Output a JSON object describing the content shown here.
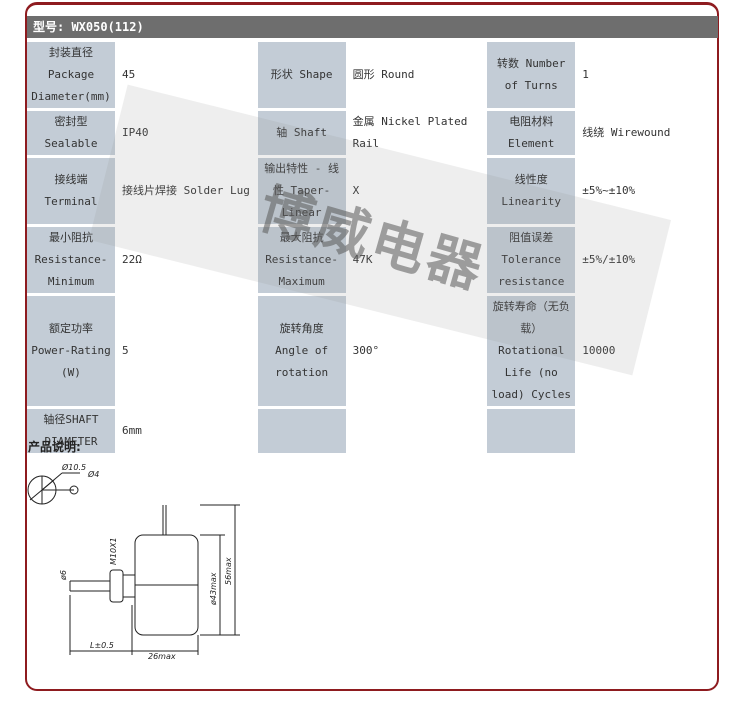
{
  "header": {
    "model_label": "型号: WX050(112)"
  },
  "spec_table": {
    "rows": [
      [
        {
          "label": "封装直径 Package Diameter(mm)",
          "value": "45"
        },
        {
          "label": "形状 Shape",
          "value": "圆形 Round"
        },
        {
          "label": "转数 Number of Turns",
          "value": "1"
        }
      ],
      [
        {
          "label": "密封型 Sealable",
          "value": "IP40"
        },
        {
          "label": "轴 Shaft",
          "value": "金属 Nickel Plated Rail"
        },
        {
          "label": "电阻材料 Element",
          "value": "线绕 Wirewound"
        }
      ],
      [
        {
          "label": "接线端 Terminal",
          "value": "接线片焊接 Solder Lug"
        },
        {
          "label": "输出特性 - 线性 Taper-Linear",
          "value": "X"
        },
        {
          "label": "线性度 Linearity",
          "value": "±5%~±10%"
        }
      ],
      [
        {
          "label": "最小阻抗 Resistance-Minimum",
          "value": "22Ω"
        },
        {
          "label": "最大阻抗 Resistance-Maximum",
          "value": "47K"
        },
        {
          "label": "阻值误差 Tolerance resistance",
          "value": "±5%/±10%"
        }
      ],
      [
        {
          "label": "额定功率 Power-Rating (W)",
          "value": "5"
        },
        {
          "label": "旋转角度 Angle of rotation",
          "value": "300°"
        },
        {
          "label": "旋转寿命（无负载）Rotational Life (no load) Cycles",
          "value": "10000"
        }
      ],
      [
        {
          "label": "轴径SHAFT DIAMETER",
          "value": "6mm"
        },
        {
          "label": "",
          "value": ""
        },
        {
          "label": "",
          "value": ""
        }
      ]
    ]
  },
  "watermark": {
    "text": "博威电器"
  },
  "description": {
    "title": "产品说明:",
    "dimensions": {
      "hole_large": "Ø10.5",
      "hole_small": "Ø4",
      "thread": "M10X1",
      "shaft_dia": "ø6",
      "body_dia": "ø43max",
      "overall_height": "56max",
      "shaft_length": "L±0.5",
      "body_depth": "26max"
    }
  }
}
